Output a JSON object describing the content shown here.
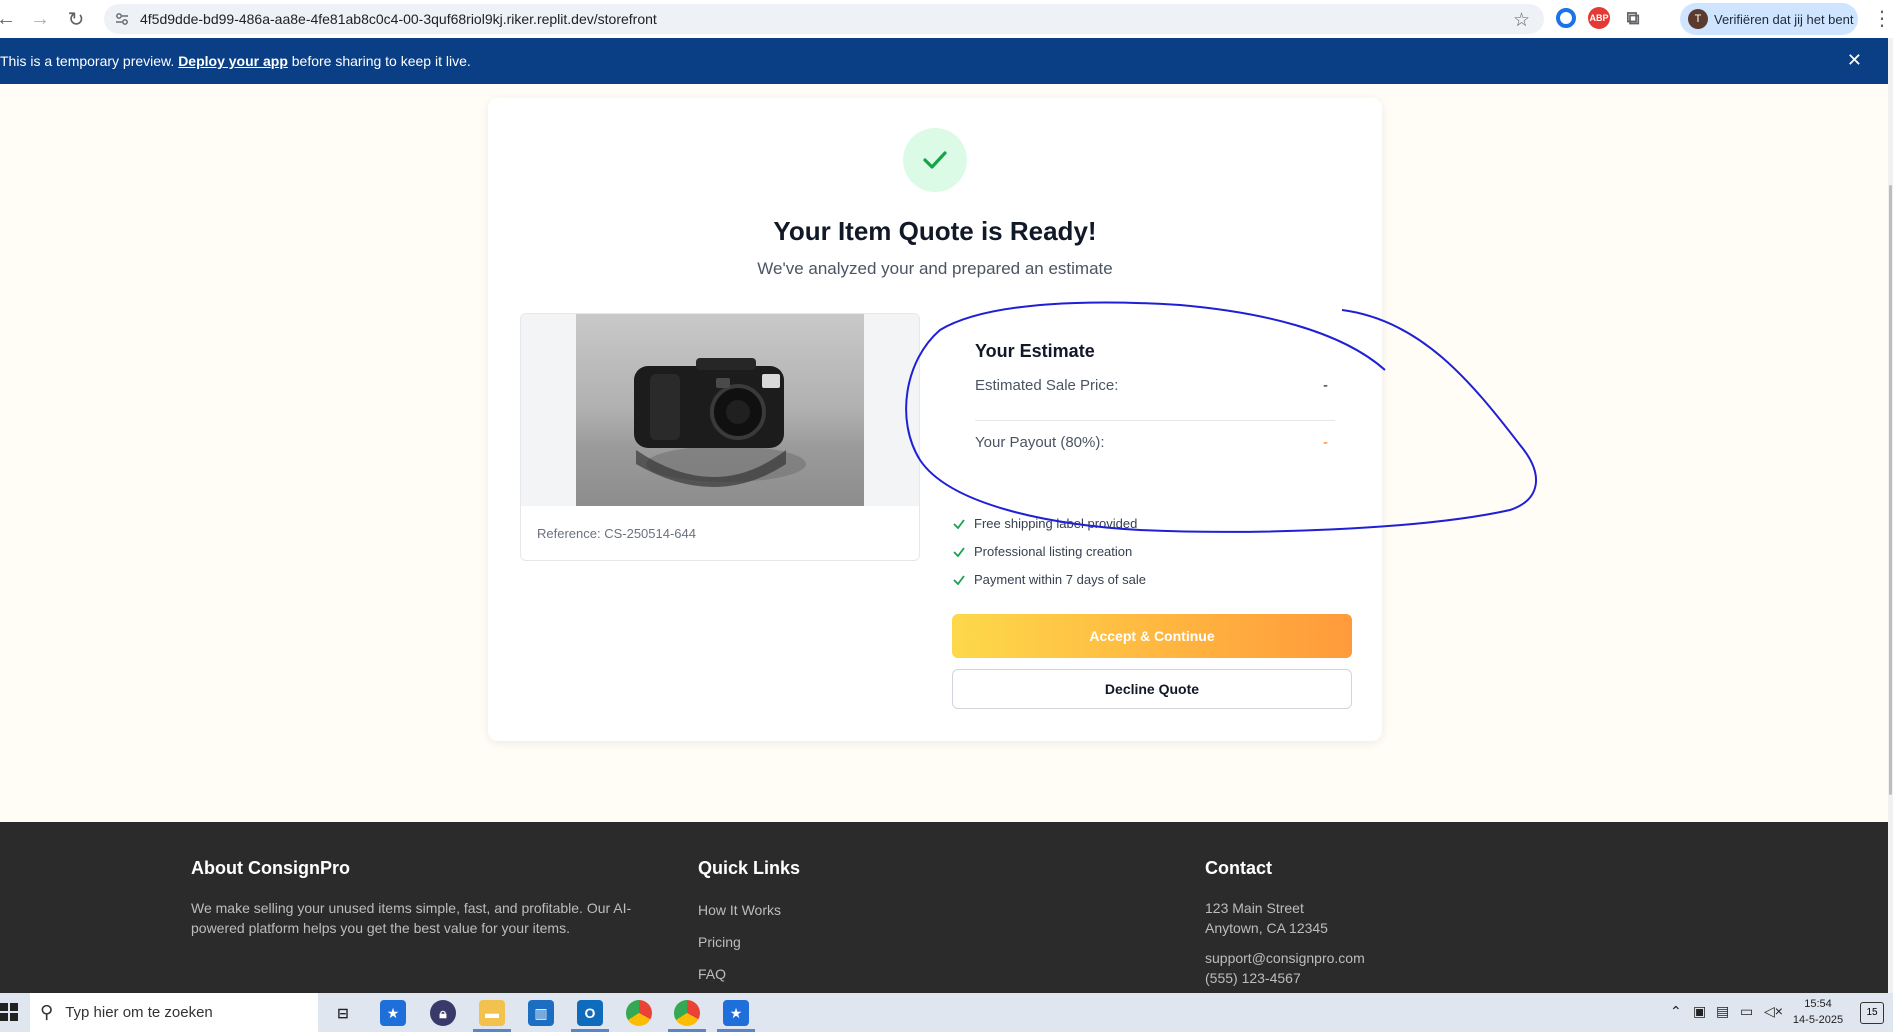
{
  "browser": {
    "url": "4f5d9dde-bd99-486a-aa8e-4fe81ab8c0c4-00-3quf68riol9kj.riker.replit.dev/storefront",
    "profile_label": "Verifiëren dat jij het bent",
    "profile_initial": "T",
    "ext_abp": "ABP"
  },
  "banner": {
    "text_before": "This is a temporary preview.",
    "link_text": "Deploy your app",
    "text_after": "before sharing to keep it live."
  },
  "quote": {
    "title": "Your Item Quote is Ready!",
    "subtitle": "We've analyzed your and prepared an estimate",
    "reference": "Reference: CS-250514-644",
    "estimate_title": "Your Estimate",
    "estimated_sale_label": "Estimated Sale Price:",
    "estimated_sale_value": "-",
    "payout_label": "Your Payout (80%):",
    "payout_value": "-",
    "features": [
      "Free shipping label provided",
      "Professional listing creation",
      "Payment within 7 days of sale"
    ],
    "accept_label": "Accept & Continue",
    "decline_label": "Decline Quote",
    "colors": {
      "accent_start": "#fdd94a",
      "accent_end": "#ff9a3b",
      "success": "#16a34a",
      "payout": "#f97316"
    }
  },
  "footer": {
    "about_heading": "About ConsignPro",
    "about_text_1": "We make selling your unused items simple, fast, and profitable. Our AI-",
    "about_text_2": "powered platform helps you get the best value for your items.",
    "links_heading": "Quick Links",
    "links": [
      "How It Works",
      "Pricing",
      "FAQ"
    ],
    "contact_heading": "Contact",
    "address_1": "123 Main Street",
    "address_2": "Anytown, CA 12345",
    "email": "support@consignpro.com",
    "phone": "(555) 123-4567"
  },
  "taskbar": {
    "search_placeholder": "Typ hier om te zoeken",
    "time": "15:54",
    "date": "14-5-2025",
    "notifications": "15"
  }
}
